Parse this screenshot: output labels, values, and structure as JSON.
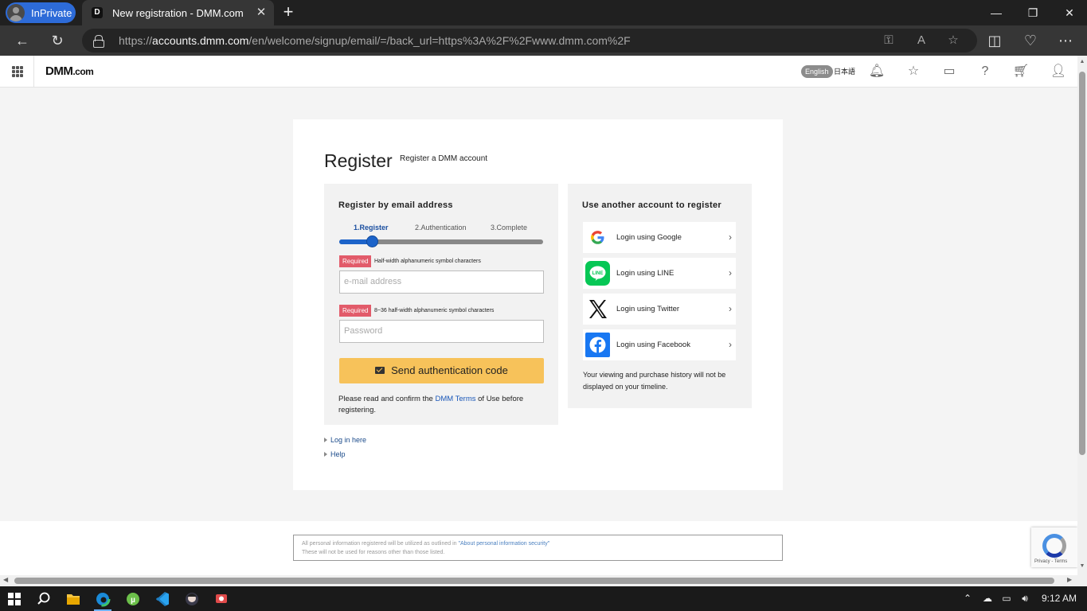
{
  "browser": {
    "inprivate_label": "InPrivate",
    "tab_title": "New registration - DMM.com",
    "tab_favicon": "D",
    "new_tab_glyph": "+",
    "url_prefix": "https://",
    "url_domain": "accounts.dmm.com",
    "url_path": "/en/welcome/signup/email/=/back_url=https%3A%2F%2Fwww.dmm.com%2F"
  },
  "site_header": {
    "logo_main": "DMM",
    "logo_suffix": ".com",
    "lang_english": "English",
    "lang_japanese": "日本語"
  },
  "page": {
    "title": "Register",
    "subtitle": "Register a DMM account"
  },
  "email_form": {
    "heading": "Register by email address",
    "steps": [
      "1.Register",
      "2.Authentication",
      "3.Complete"
    ],
    "active_step": 1,
    "progress": 0.16,
    "email_required_tag": "Required",
    "email_note": "Half-width alphanumeric symbol characters",
    "email_placeholder": "e-mail address",
    "password_required_tag": "Required",
    "password_note": "8~36 half-width alphanumeric symbol characters",
    "password_placeholder": "Password",
    "send_button": "Send authentication code",
    "confirm_before": "Please read and confirm the ",
    "confirm_link": "DMM Terms",
    "confirm_after": " of Use before registering."
  },
  "links": {
    "login": "Log in here",
    "help": "Help"
  },
  "sns": {
    "heading": "Use another account to register",
    "items": [
      {
        "label": "Login using Google",
        "icon": "google-icon"
      },
      {
        "label": "Login using LINE",
        "icon": "line-icon"
      },
      {
        "label": "Login using Twitter",
        "icon": "x-twitter-icon"
      },
      {
        "label": "Login using Facebook",
        "icon": "facebook-icon"
      }
    ],
    "notice": "Your viewing and purchase history will not be displayed on your timeline."
  },
  "footer": {
    "line1_before": "All personal information registered will be utilized as outlined in ",
    "line1_link": "\"About personal information security\"",
    "line2": "These will not be used for reasons other than those listed.",
    "recaptcha_text": "Privacy - Terms"
  },
  "taskbar": {
    "time": "9:12 AM"
  },
  "colors": {
    "accent_blue": "#1c63c9",
    "send_button": "#f7c25a",
    "required_tag": "#e25b6a"
  }
}
